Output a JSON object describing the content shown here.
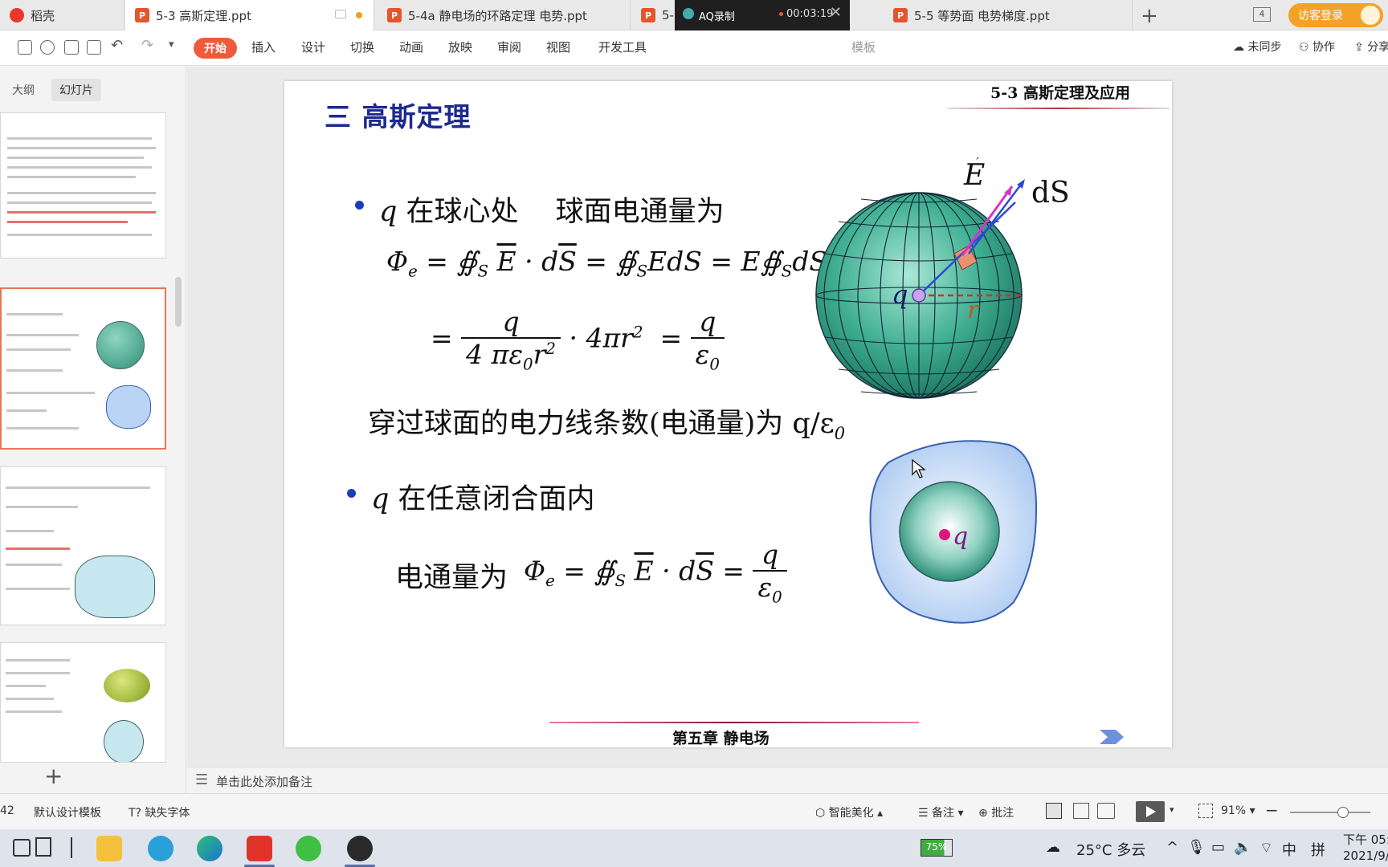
{
  "tabs": [
    {
      "label": "稻壳",
      "active": false
    },
    {
      "label": "5-3 高斯定理.ppt",
      "active": true
    },
    {
      "label": "5-4a 静电场的环路定理 电势.ppt",
      "active": false
    },
    {
      "label": "5-...",
      "active": false
    },
    {
      "label": "5-5 等势面 电势梯度.ppt",
      "active": false
    }
  ],
  "tab_count": "4",
  "login_label": "访客登录",
  "recorder": {
    "title": "AQ录制",
    "time": "00:03:19"
  },
  "ribbon": {
    "start": "开始",
    "menus": [
      "插入",
      "设计",
      "切换",
      "动画",
      "放映",
      "审阅",
      "视图",
      "开发工具"
    ],
    "hidden_menu_tail": "模板",
    "sync": "未同步",
    "collab": "协作",
    "share": "分享"
  },
  "left_panel": {
    "outline_tab": "大纲",
    "slides_tab": "幻灯片"
  },
  "slide": {
    "header": "5-3  高斯定理及应用",
    "title": "三 高斯定理",
    "b1_q": "q",
    "b1_text": "在球心处　 球面电通量为",
    "flux_line": "穿过球面的电力线条数(电通量)为 q/ε",
    "flux_sub": "0",
    "b2_q": "q",
    "b2_text": "在任意闭合面内",
    "b2_flux": "电通量为",
    "footer": "第五章  静电场",
    "fig_E": "E",
    "fig_dS": "dS",
    "fig_q": "q",
    "fig_r": "r",
    "fig2_q": "q"
  },
  "notes_placeholder": "单击此处添加备注",
  "status": {
    "slide_no": "42",
    "template": "默认设计模板",
    "missing_font": "缺失字体",
    "beautify": "智能美化",
    "notes": "备注",
    "comment": "批注",
    "zoom": "91%",
    "zoom_fraction": 0.66
  },
  "taskbar": {
    "battery": "75%",
    "weather": "25°C  多云",
    "ime": "中",
    "ime2": "拼",
    "time": "下午 05:",
    "date": "2021/9/"
  },
  "colors": {
    "accent": "#ef5a3b",
    "title_blue": "#1d2a8f",
    "sphere": "#3aa58a",
    "surface": "#b9d4f5"
  }
}
